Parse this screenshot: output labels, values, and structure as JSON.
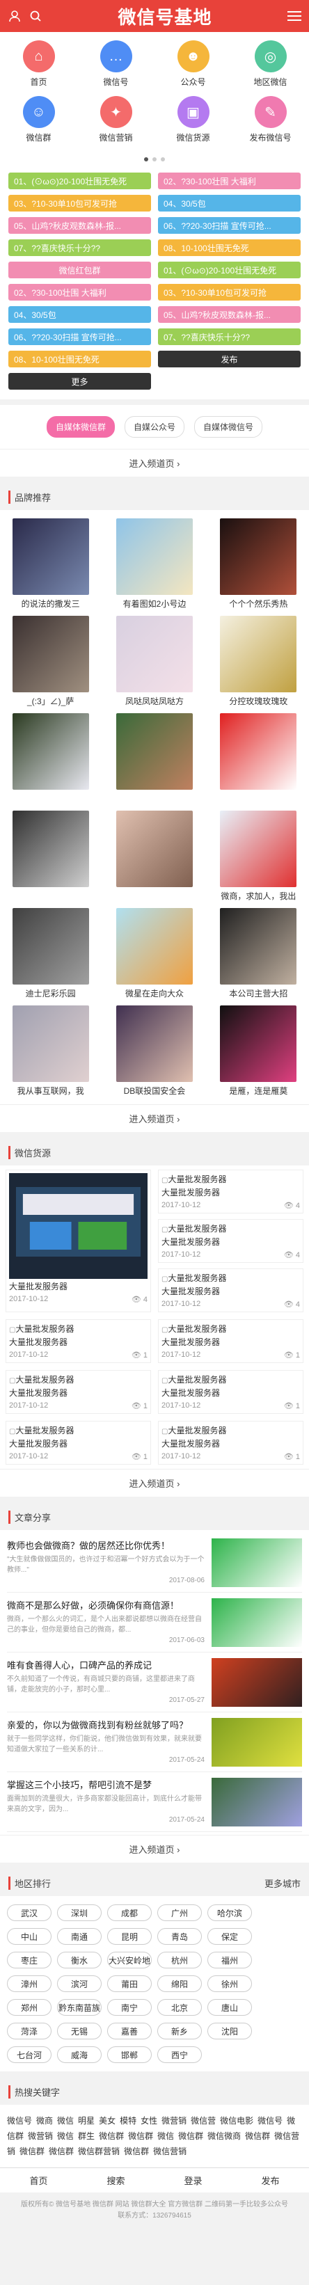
{
  "header": {
    "title": "微信号基地"
  },
  "nav": [
    {
      "label": "首页",
      "color": "#f46b6b",
      "icon": "home-icon",
      "glyph": "⌂"
    },
    {
      "label": "微信号",
      "color": "#4f8df5",
      "icon": "chat-icon",
      "glyph": "…"
    },
    {
      "label": "公众号",
      "color": "#f5b63b",
      "icon": "official-account-icon",
      "glyph": "☻"
    },
    {
      "label": "地区微信",
      "color": "#54c79c",
      "icon": "globe-icon",
      "glyph": "◎"
    },
    {
      "label": "微信群",
      "color": "#4f8df5",
      "icon": "group-icon",
      "glyph": "☺"
    },
    {
      "label": "微信营销",
      "color": "#f46b6b",
      "icon": "marketing-icon",
      "glyph": "✦"
    },
    {
      "label": "微信货源",
      "color": "#b47af0",
      "icon": "bag-icon",
      "glyph": "▣"
    },
    {
      "label": "发布微信号",
      "color": "#f07ab0",
      "icon": "publish-icon",
      "glyph": "✎"
    }
  ],
  "tags": [
    {
      "text": "01、(⊙ω⊙)20-100壮围无免死",
      "color": "#9bcf55"
    },
    {
      "text": "02、?30-100壮围 大福利",
      "color": "#f28db2"
    },
    {
      "text": "03、?10-30单10包可发可抢",
      "color": "#f5b63b"
    },
    {
      "text": "04、30/5包",
      "color": "#55b5e8"
    },
    {
      "text": "05、山鸡?秋皮观数森林-报...",
      "color": "#f28db2"
    },
    {
      "text": "06、??20-30扫描 宣传可抢...",
      "color": "#55b5e8"
    },
    {
      "text": "07、??喜庆快乐十分??",
      "color": "#9bcf55"
    },
    {
      "text": "08、10-100壮围无免死",
      "color": "#f5b63b"
    },
    {
      "text": "微信红包群",
      "color": "#f28db2",
      "center": true
    },
    {
      "text": "01、(⊙ω⊙)20-100壮围无免死",
      "color": "#9bcf55"
    },
    {
      "text": "02、?30-100壮围 大福利",
      "color": "#f28db2"
    },
    {
      "text": "03、?10-30单10包可发可抢",
      "color": "#f5b63b"
    },
    {
      "text": "04、30/5包",
      "color": "#55b5e8"
    },
    {
      "text": "05、山鸡?秋皮观数森林-报...",
      "color": "#f28db2"
    },
    {
      "text": "06、??20-30扫描 宣传可抢...",
      "color": "#55b5e8"
    },
    {
      "text": "07、??喜庆快乐十分??",
      "color": "#9bcf55"
    },
    {
      "text": "08、10-100壮围无免死",
      "color": "#f5b63b"
    },
    {
      "text": "发布",
      "color": "#333333",
      "center": true
    },
    {
      "text": "更多",
      "color": "#333333",
      "center": true
    }
  ],
  "subtabs": [
    "自媒体微信群",
    "自媒公众号",
    "自媒体微信号"
  ],
  "enter_label": "进入频道页 ›",
  "brand": {
    "title": "品牌推荐",
    "items": [
      {
        "cap": "的说法的撒发三",
        "c1": "#2a2a4a",
        "c2": "#7a8ab0"
      },
      {
        "cap": "有着图如2小号边",
        "c1": "#8fc4e8",
        "c2": "#f4e6c0"
      },
      {
        "cap": "个个个然乐秀热",
        "c1": "#1a1010",
        "c2": "#b0503a"
      },
      {
        "cap": "_(:3」∠)_萨",
        "c1": "#3a3030",
        "c2": "#a09080"
      },
      {
        "cap": "凤哒凤哒凤哒方",
        "c1": "#d8d0e0",
        "c2": "#f4e0e8"
      },
      {
        "cap": "分控玫瑰玫瑰玫",
        "c1": "#f4f0e0",
        "c2": "#c0a040"
      },
      {
        "cap": "",
        "c1": "#2a3a20",
        "c2": "#e8e8f0"
      },
      {
        "cap": "",
        "c1": "#3a6a3a",
        "c2": "#c08060"
      },
      {
        "cap": "",
        "c1": "#e02020",
        "c2": "#ffffff"
      },
      {
        "cap": "",
        "c1": "#303030",
        "c2": "#d0d0d0"
      },
      {
        "cap": "",
        "c1": "#e0c0b0",
        "c2": "#806050"
      },
      {
        "cap": "微商，求加人，我出",
        "c1": "#e8f0f8",
        "c2": "#e03030"
      },
      {
        "cap": "迪士尼彩乐园",
        "c1": "#404040",
        "c2": "#a0a0a0"
      },
      {
        "cap": "微星在走向大众",
        "c1": "#b0e0f0",
        "c2": "#f0a040"
      },
      {
        "cap": "本公司主营大招",
        "c1": "#202020",
        "c2": "#c0b0a0"
      },
      {
        "cap": "我从事互联网，我",
        "c1": "#a0a0b0",
        "c2": "#e0d0d0"
      },
      {
        "cap": "DB联投国安全会",
        "c1": "#403050",
        "c2": "#e0c0b0"
      },
      {
        "cap": "是雁，连是雁莫",
        "c1": "#101010",
        "c2": "#e04080"
      }
    ]
  },
  "source": {
    "title": "微信货源",
    "big": {
      "title": "大量批发服务器",
      "date": "2017-10-12",
      "views": "4"
    },
    "side": [
      {
        "title": "大量批发服务器",
        "date": "2017-10-12",
        "views": "4"
      },
      {
        "title": "大量批发服务器",
        "date": "2017-10-12",
        "views": "4"
      },
      {
        "title": "大量批发服务器",
        "date": "2017-10-12",
        "views": "4"
      }
    ],
    "grid": [
      {
        "title": "大量批发服务器",
        "date": "2017-10-12",
        "views": "1"
      },
      {
        "title": "大量批发服务器",
        "date": "2017-10-12",
        "views": "1"
      },
      {
        "title": "大量批发服务器",
        "date": "2017-10-12",
        "views": "1"
      },
      {
        "title": "大量批发服务器",
        "date": "2017-10-12",
        "views": "1"
      },
      {
        "title": "大量批发服务器",
        "date": "2017-10-12",
        "views": "1"
      },
      {
        "title": "大量批发服务器",
        "date": "2017-10-12",
        "views": "1"
      }
    ]
  },
  "articles": {
    "title": "文章分享",
    "items": [
      {
        "t": "教师也会做微商？做的居然还比你优秀！",
        "d": "\"大生就像做做国员的，也许过于和沼冪一个好方式会以为于一个教师...\"",
        "date": "2017-08-06",
        "c1": "#2db34a",
        "c2": "#ffffff"
      },
      {
        "t": "微商不是那么好做，必须确保你有商信源！",
        "d": "微商，一个那么火的词汇，是个人出来都说都想以微商在经营自己的事业，但你是要给自己的微商，都...",
        "date": "2017-06-03",
        "c1": "#2db34a",
        "c2": "#ffffff"
      },
      {
        "t": "唯有食善得人心，口碑产品的养成记",
        "d": "不久前知道了一个传说，有商城只要的商铺，这里都进来了商铺，走能放完的小子，那时心里...",
        "date": "2017-05-27",
        "c1": "#d04020",
        "c2": "#302020"
      },
      {
        "t": "亲爱的，你以为做微商找到有粉丝就够了吗？",
        "d": "就于一些同学这样，你们能说，他们微信做到有效果，就来就要知道做大家拉了一些关系的计...",
        "date": "2017-05-24",
        "c1": "#80a020",
        "c2": "#e0e040"
      },
      {
        "t": "掌握这三个小技巧，帮吧引流不是梦",
        "d": "面需加到的流量很大，许多商家都没能回高计，到底什么才能带来高的文字，因为...",
        "date": "2017-05-24",
        "c1": "#3a6a3a",
        "c2": "#a0a0e0"
      }
    ]
  },
  "regions": {
    "title": "地区排行",
    "more": "更多城市",
    "items": [
      "武汉",
      "深圳",
      "成都",
      "广州",
      "哈尔滨",
      "",
      "中山",
      "南通",
      "昆明",
      "青岛",
      "保定",
      "",
      "枣庄",
      "衡水",
      "大兴安岭地",
      "杭州",
      "福州",
      "",
      "漳州",
      "滨河",
      "莆田",
      "绵阳",
      "徐州",
      "",
      "郑州",
      "黔东南苗族",
      "南宁",
      "北京",
      "唐山",
      "",
      "菏泽",
      "无锡",
      "嘉善",
      "新乡",
      "沈阳",
      "",
      "七台河",
      "威海",
      "邯郸",
      "西宁",
      "",
      ""
    ]
  },
  "hot": {
    "title": "热搜关键字",
    "words": [
      "微信号",
      "微商",
      "微信",
      "明星",
      "美女",
      "模特",
      "女性",
      "微营销",
      "微信营",
      "微信电影",
      "微信号",
      "微信群",
      "微营销",
      "微信",
      "群生",
      "微信群",
      "微信群",
      "微信",
      "微信群",
      "微信微商",
      "微信群",
      "微信营销",
      "微信群",
      "",
      "",
      "",
      "",
      "",
      "",
      "",
      "",
      "",
      "微信群",
      "微信群营销",
      "微信群",
      "微信营销"
    ]
  },
  "bottom_nav": [
    "首页",
    "搜索",
    "登录",
    "发布"
  ],
  "footer": {
    "line1": "版权所有© 微信号基地 微信群 网站 微信群大全 官方微信群 二维码第一手比较多公众号",
    "line2": "联系方式：1326794615"
  }
}
